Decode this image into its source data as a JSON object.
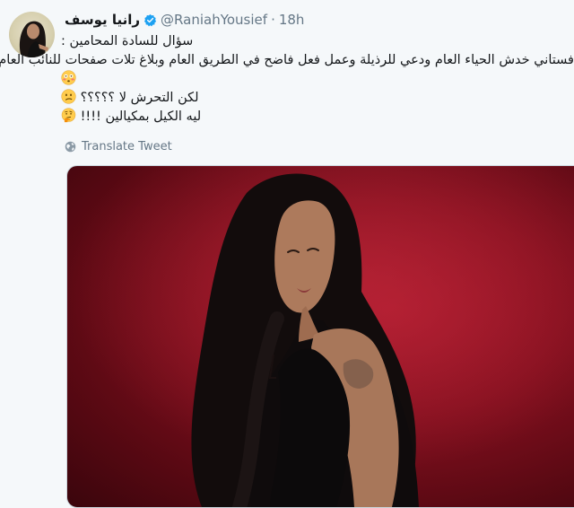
{
  "tweet": {
    "display_name": "رانيا يوسف",
    "handle": "@RaniahYousief",
    "separator": "·",
    "time": "18h",
    "lines": [
      "سؤال للسادة المحامين :",
      "فستاني خدش الحياء العام ودعي للرذيلة وعمل فعل فاضح في الطريق العام  وبلاغ تلات صفحات للنائب العام",
      "",
      "لكن التحرش لا ؟؟؟؟؟",
      "ليه الكيل بمكيالين !!!!"
    ],
    "translate_label": "Translate Tweet"
  },
  "icons": {
    "verified": "verified-badge-icon",
    "globe": "globe-icon",
    "emoji_flushed": "flushed-face-emoji",
    "emoji_confused": "confused-face-emoji",
    "emoji_thinking": "thinking-face-emoji"
  },
  "colors": {
    "verified_blue": "#1da1f2",
    "muted_text": "#657786",
    "media_red": "#84101f"
  }
}
